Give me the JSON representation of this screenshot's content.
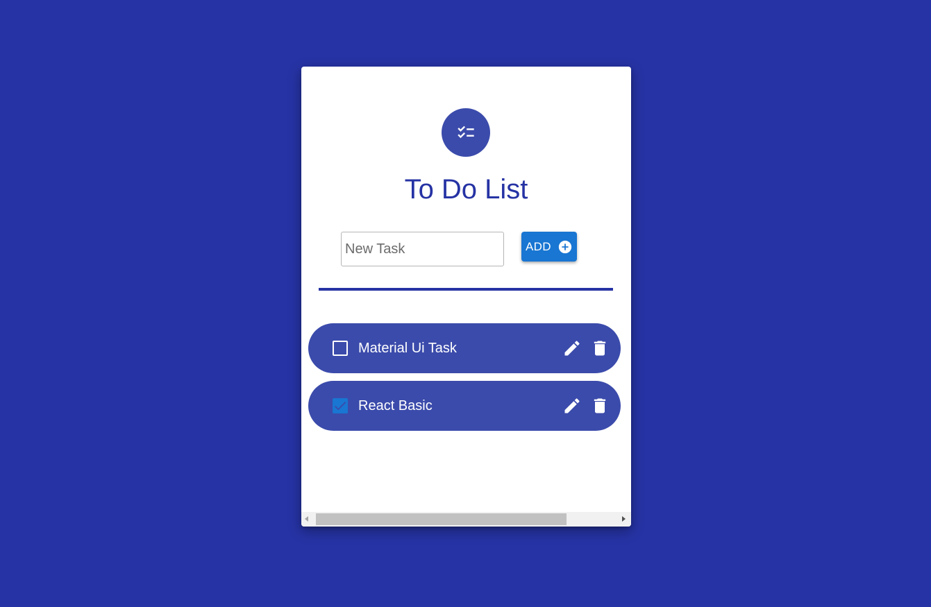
{
  "app": {
    "title": "To Do List",
    "header_icon": "checklist-icon"
  },
  "form": {
    "input_placeholder": "New Task",
    "input_value": "",
    "add_label": "ADD",
    "add_icon": "add-circle-icon"
  },
  "tasks": [
    {
      "label": "Material Ui Task",
      "checked": false,
      "edit_icon": "edit-icon",
      "delete_icon": "delete-icon"
    },
    {
      "label": "React Basic",
      "checked": true,
      "edit_icon": "edit-icon",
      "delete_icon": "delete-icon"
    }
  ],
  "colors": {
    "background": "#2633a4",
    "accent": "#3b4bab",
    "primary": "#1976d2",
    "card": "#ffffff"
  },
  "scrollbar": {
    "orientation": "horizontal",
    "thumb_fraction": 0.83,
    "position_fraction": 0.0
  }
}
